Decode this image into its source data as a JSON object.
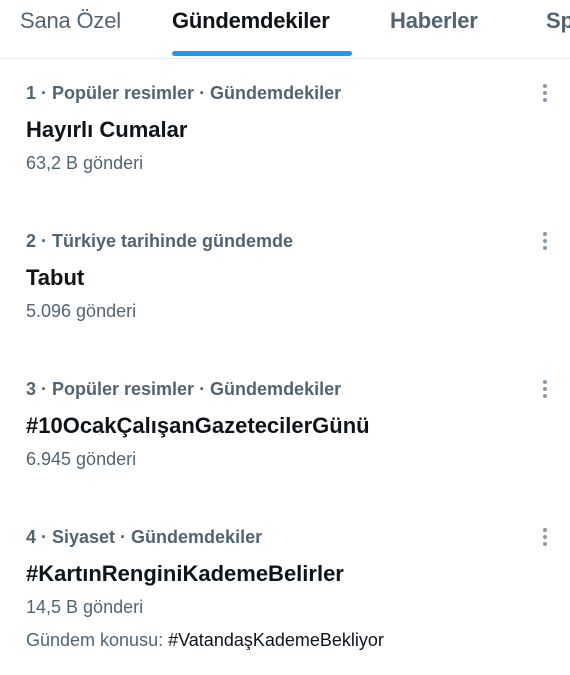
{
  "tabs": [
    {
      "label": "Sana Özel",
      "active": false
    },
    {
      "label": "Gündemdekiler",
      "active": true
    },
    {
      "label": "Haberler",
      "active": false
    },
    {
      "label": "Sp",
      "active": false
    }
  ],
  "trends": [
    {
      "meta": "1 · Popüler resimler · Gündemdekiler",
      "title": "Hayırlı Cumalar",
      "count": "63,2 B gönderi"
    },
    {
      "meta": "2 · Türkiye tarihinde gündemde",
      "title": "Tabut",
      "count": "5.096 gönderi"
    },
    {
      "meta": "3 · Popüler resimler · Gündemdekiler",
      "title": "#10OcakÇalışanGazetecilerGünü",
      "count": "6.945 gönderi"
    },
    {
      "meta": "4 · Siyaset · Gündemdekiler",
      "title": "#KartınRenginiKademeBelirler",
      "count": "14,5 B gönderi",
      "topic_prefix": "Gündem konusu:",
      "topic_link": "#VatandaşKademeBekliyor"
    }
  ],
  "colors": {
    "accent": "#1d9bf0",
    "text_primary": "#0f1419",
    "text_secondary": "#536471"
  },
  "icons": {
    "more": "more-vertical-icon"
  }
}
